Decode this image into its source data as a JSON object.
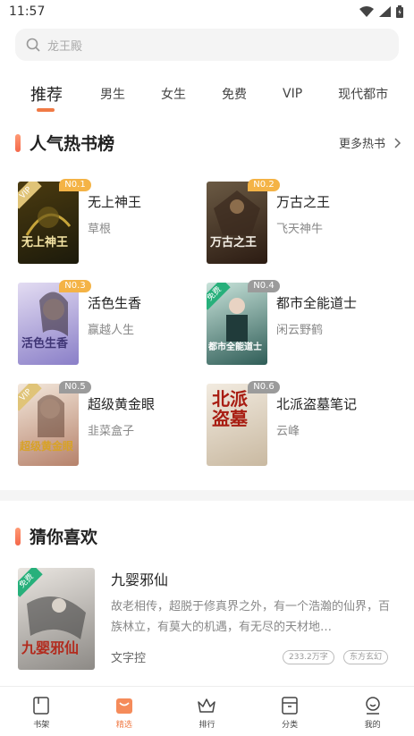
{
  "status": {
    "time": "11:57"
  },
  "search": {
    "placeholder": "龙王殿"
  },
  "tabs": [
    {
      "label": "推荐",
      "active": true
    },
    {
      "label": "男生"
    },
    {
      "label": "女生"
    },
    {
      "label": "免费"
    },
    {
      "label": "VIP"
    },
    {
      "label": "现代都市"
    }
  ],
  "hot": {
    "title": "人气热书榜",
    "more": "更多热书",
    "books": [
      {
        "rank": "N0.1",
        "title": "无上神王",
        "author": "草根",
        "tag": "VIP",
        "cover_text": "无上神王",
        "colors": [
          "#4b3b10",
          "#1c1a0b"
        ]
      },
      {
        "rank": "N0.2",
        "title": "万古之王",
        "author": "飞天神牛",
        "tag": "",
        "cover_text": "万古之王",
        "colors": [
          "#6b5a44",
          "#2b1b12"
        ]
      },
      {
        "rank": "N0.3",
        "title": "活色生香",
        "author": "赢越人生",
        "tag": "",
        "cover_text": "活色生香",
        "colors": [
          "#b8a9d8",
          "#8a7fc8"
        ]
      },
      {
        "rank": "N0.4",
        "title": "都市全能道士",
        "author": "闲云野鹤",
        "tag": "免费",
        "cover_text": "都市全能道士",
        "colors": [
          "#7ab3a6",
          "#2f5d57"
        ]
      },
      {
        "rank": "N0.5",
        "title": "超级黄金眼",
        "author": "韭菜盒子",
        "tag": "VIP",
        "cover_text": "超级黄金眼",
        "colors": [
          "#e9d7c7",
          "#b6826b"
        ]
      },
      {
        "rank": "N0.6",
        "title": "北派盗墓笔记",
        "author": "云峰",
        "tag": "",
        "cover_text": "北派盗墓",
        "colors": [
          "#ede3d4",
          "#c9b9a1"
        ]
      }
    ]
  },
  "guess": {
    "title": "猜你喜欢",
    "book": {
      "title": "九婴邪仙",
      "desc": "故老相传，超脱于修真界之外，有一个浩瀚的仙界，百族林立，有莫大的机遇，有无尽的天材地…",
      "author": "文字控",
      "tags": [
        "233.2万字",
        "东方玄幻"
      ],
      "free_tag": "免费",
      "cover_text": "九婴邪仙"
    }
  },
  "nav": [
    {
      "label": "书架",
      "icon": "bookshelf-icon"
    },
    {
      "label": "精选",
      "icon": "featured-icon",
      "active": true
    },
    {
      "label": "排行",
      "icon": "crown-icon"
    },
    {
      "label": "分类",
      "icon": "category-icon"
    },
    {
      "label": "我的",
      "icon": "profile-icon"
    }
  ],
  "colors": {
    "accent": "#f07a45",
    "badge_gold": "#f4b346",
    "badge_gray": "#9b9b9b"
  }
}
